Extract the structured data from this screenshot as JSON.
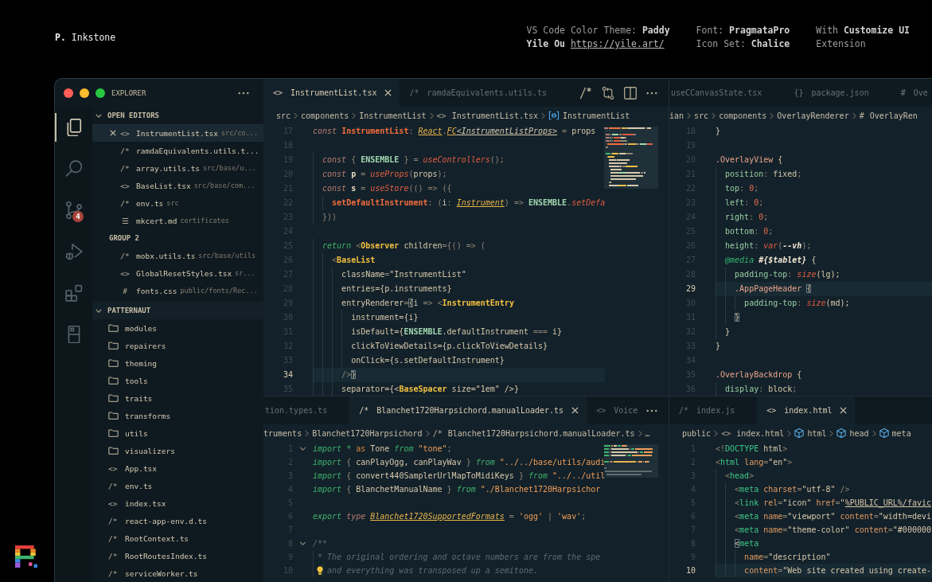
{
  "header": {
    "brand": "**P.** Inkstone",
    "credits": [
      {
        "lines": [
          "VS Code Color Theme: **Paddy**"
        ],
        "author": "Yile Ou",
        "link": "https://yile.art/"
      },
      {
        "lines": [
          "Font: **PragmataPro**",
          "Icon Set: **Chalice**"
        ]
      },
      {
        "lines": [
          "With **Customize UI**",
          "Extension"
        ]
      }
    ]
  },
  "activity_bar": [
    {
      "kind": "explorer",
      "selected": true
    },
    {
      "kind": "search",
      "selected": false
    },
    {
      "kind": "source-control",
      "selected": false,
      "badge": "4"
    },
    {
      "kind": "run-debug",
      "selected": false
    },
    {
      "kind": "extensions",
      "selected": false
    },
    {
      "kind": "device",
      "selected": false
    }
  ],
  "explorer": {
    "title": "EXPLORER",
    "open_editors": {
      "title": "OPEN EDITORS",
      "expanded": true,
      "groups": [
        {
          "items": [
            {
              "icon": "<>",
              "name": "InstrumentList.tsx",
              "path": "src/co...",
              "selected": true
            },
            {
              "icon": "/*",
              "name": "ramdaEquivalents.utils.t...",
              "selected": false
            },
            {
              "icon": "/*",
              "name": "array.utils.ts",
              "path": "src/base/u...",
              "selected": false
            },
            {
              "icon": "<>",
              "name": "BaseList.tsx",
              "path": "src/base/com...",
              "selected": false
            },
            {
              "icon": "/*",
              "name": "env.ts",
              "path": "src",
              "selected": false
            },
            {
              "icon": "☰",
              "name": "mkcert.md",
              "path": "certificates",
              "selected": false
            }
          ]
        },
        {
          "title": "GROUP 2",
          "items": [
            {
              "icon": "/*",
              "name": "mobx.utils.ts",
              "path": "src/base/utils",
              "selected": false
            },
            {
              "icon": "<>",
              "name": "GlobalResetStyles.tsx",
              "path": "sr...",
              "selected": false
            },
            {
              "icon": "#",
              "name": "fonts.css",
              "path": "public/fonts/Rec...",
              "selected": false
            }
          ]
        }
      ]
    },
    "project": {
      "title": "PATTERNAUT",
      "expanded": true,
      "items": [
        {
          "kind": "folder",
          "name": "modules"
        },
        {
          "kind": "folder",
          "name": "repairers"
        },
        {
          "kind": "folder",
          "name": "theming"
        },
        {
          "kind": "folder",
          "name": "tools"
        },
        {
          "kind": "folder",
          "name": "traits"
        },
        {
          "kind": "folder",
          "name": "transforms"
        },
        {
          "kind": "folder",
          "name": "utils"
        },
        {
          "kind": "folder",
          "name": "visualizers"
        },
        {
          "kind": "file",
          "icon": "<>",
          "name": "App.tsx"
        },
        {
          "kind": "file",
          "icon": "/*",
          "name": "env.ts"
        },
        {
          "kind": "file",
          "icon": "<>",
          "name": "index.tsx"
        },
        {
          "kind": "file",
          "icon": "/*",
          "name": "react-app-env.d.ts"
        },
        {
          "kind": "file",
          "icon": "/*",
          "name": "RootContext.ts"
        },
        {
          "kind": "file",
          "icon": "/*",
          "name": "RootRoutesIndex.ts"
        },
        {
          "kind": "file",
          "icon": "/*",
          "name": "serviceWorker.ts"
        }
      ]
    }
  },
  "editors": [
    {
      "tabs": [
        {
          "icon": "<>",
          "label": "InstrumentList.tsx",
          "selected": true
        },
        {
          "icon": "/*",
          "label": "ramdaEquivalents.utils.ts",
          "selected": false
        }
      ],
      "actions": [
        {
          "kind": "toggle-comment"
        },
        {
          "kind": "compare"
        },
        {
          "kind": "split"
        },
        {
          "kind": "more"
        }
      ],
      "breadcrumbs": [
        {
          "kind": "path",
          "text": "src"
        },
        {
          "kind": "path",
          "text": "components"
        },
        {
          "kind": "path",
          "text": "InstrumentList"
        },
        {
          "kind": "file",
          "icon": "<>",
          "text": "InstrumentList.tsx"
        },
        {
          "kind": "variable",
          "text": "InstrumentList"
        }
      ],
      "minimap": true,
      "lines": [
        {
          "number": "17",
          "current": false,
          "tokens": [
            {
              "text": "const ",
              "kind": "keyword"
            },
            {
              "text": "InstrumentList",
              "kind": "decl"
            },
            {
              "text": ": ",
              "kind": "punct"
            },
            {
              "text": "React",
              "kind": "type"
            },
            {
              "text": ".",
              "kind": "punct"
            },
            {
              "text": "FC",
              "kind": "type"
            },
            {
              "text": "<InstrumentListProps>",
              "kind": "typeparam"
            },
            {
              "text": " = ",
              "kind": "punct"
            },
            {
              "text": "props",
              "kind": "plain"
            }
          ]
        },
        {
          "number": "18",
          "current": false
        },
        {
          "number": "19",
          "current": false,
          "tokens": [
            {
              "text": "  const ",
              "kind": "keyword"
            },
            {
              "text": "{ ",
              "kind": "punct"
            },
            {
              "text": "ENSEMBLE",
              "kind": "const"
            },
            {
              "text": " } = ",
              "kind": "punct"
            },
            {
              "text": "useControllers",
              "kind": "func"
            },
            {
              "text": "();",
              "kind": "punct"
            }
          ]
        },
        {
          "number": "20",
          "current": false,
          "tokens": [
            {
              "text": "  const ",
              "kind": "keyword"
            },
            {
              "text": "p",
              "kind": "var"
            },
            {
              "text": " = ",
              "kind": "punct"
            },
            {
              "text": "useProps",
              "kind": "func"
            },
            {
              "text": "(",
              "kind": "punct"
            },
            {
              "text": "props",
              "kind": "plain"
            },
            {
              "text": ");",
              "kind": "punct"
            }
          ]
        },
        {
          "number": "21",
          "current": false,
          "tokens": [
            {
              "text": "  const ",
              "kind": "keyword"
            },
            {
              "text": "s",
              "kind": "var"
            },
            {
              "text": " = ",
              "kind": "punct"
            },
            {
              "text": "useStore",
              "kind": "func"
            },
            {
              "text": "(() => ({",
              "kind": "punct"
            }
          ]
        },
        {
          "number": "22",
          "current": false,
          "tokens": [
            {
              "text": "    setDefaultInstrument",
              "kind": "decl"
            },
            {
              "text": ": (",
              "kind": "punct"
            },
            {
              "text": "i",
              "kind": "plain"
            },
            {
              "text": ": ",
              "kind": "punct"
            },
            {
              "text": "Instrument",
              "kind": "type"
            },
            {
              "text": ") => ",
              "kind": "punct"
            },
            {
              "text": "ENSEMBLE",
              "kind": "const"
            },
            {
              "text": ".",
              "kind": "punct"
            },
            {
              "text": "setDefa",
              "kind": "func"
            }
          ]
        },
        {
          "number": "23",
          "current": false,
          "tokens": [
            {
              "text": "  }))",
              "kind": "punct"
            }
          ]
        },
        {
          "number": "24",
          "current": false
        },
        {
          "number": "25",
          "current": false,
          "tokens": [
            {
              "text": "  return ",
              "kind": "control"
            },
            {
              "text": "<",
              "kind": "punct"
            },
            {
              "text": "Observer",
              "kind": "tag"
            },
            {
              "text": " children",
              "kind": "plain"
            },
            {
              "text": "={() => (",
              "kind": "punct"
            }
          ]
        },
        {
          "number": "26",
          "current": false,
          "tokens": [
            {
              "text": "    <",
              "kind": "punct"
            },
            {
              "text": "BaseList",
              "kind": "tag"
            }
          ]
        },
        {
          "number": "27",
          "current": false,
          "tokens": [
            {
              "text": "      className",
              "kind": "plain"
            },
            {
              "text": "=",
              "kind": "punct"
            },
            {
              "text": "\"InstrumentList\"",
              "kind": "plain"
            }
          ]
        },
        {
          "number": "28",
          "current": false,
          "tokens": [
            {
              "text": "      entries={p.instruments}",
              "kind": "plain"
            }
          ]
        },
        {
          "number": "29",
          "current": false,
          "tokens": [
            {
              "text": "      entryRenderer",
              "kind": "plain"
            },
            {
              "text": "=",
              "kind": "punct"
            },
            {
              "text": "{",
              "kind": "match"
            },
            {
              "text": "i",
              "kind": "plain"
            },
            {
              "text": " => <",
              "kind": "punct"
            },
            {
              "text": "InstrumentEntry",
              "kind": "tag"
            }
          ]
        },
        {
          "number": "30",
          "current": false,
          "tokens": [
            {
              "text": "        instrument={i}",
              "kind": "plain"
            }
          ]
        },
        {
          "number": "31",
          "current": false,
          "tokens": [
            {
              "text": "        isDefault={",
              "kind": "plain"
            },
            {
              "text": "ENSEMBLE",
              "kind": "const"
            },
            {
              "text": ".defaultInstrument ",
              "kind": "plain"
            },
            {
              "text": "===",
              "kind": "punct"
            },
            {
              "text": " i}",
              "kind": "plain"
            }
          ]
        },
        {
          "number": "32",
          "current": false,
          "tokens": [
            {
              "text": "        clickToViewDetails={p.clickToViewDetails}",
              "kind": "plain"
            }
          ]
        },
        {
          "number": "33",
          "current": false,
          "tokens": [
            {
              "text": "        onClick={s.setDefaultInstrument}",
              "kind": "plain"
            }
          ]
        },
        {
          "number": "34",
          "current": true,
          "tokens": [
            {
              "text": "      />",
              "kind": "punct"
            },
            {
              "text": "}",
              "kind": "match"
            }
          ]
        },
        {
          "number": "35",
          "current": false,
          "tokens": [
            {
              "text": "      separator={<",
              "kind": "plain"
            },
            {
              "text": "BaseSpacer",
              "kind": "tag"
            },
            {
              "text": " size=\"1em\" />}",
              "kind": "plain"
            }
          ]
        }
      ]
    },
    {
      "tabs": [
        {
          "label": "useCCanvasState.tsx",
          "selected": false
        },
        {
          "icon": "{}",
          "label": "package.json",
          "selected": false
        },
        {
          "icon": "#",
          "label": "Ove",
          "selected": false
        }
      ],
      "breadcrumbs": [
        {
          "kind": "path",
          "text": "ian"
        },
        {
          "kind": "path",
          "text": "src"
        },
        {
          "kind": "path",
          "text": "components"
        },
        {
          "kind": "path",
          "text": "OverlayRenderer"
        },
        {
          "kind": "file",
          "icon": "#",
          "text": "OverlayRen"
        }
      ],
      "lines": [
        {
          "number": "18",
          "current": false,
          "tokens": [
            {
              "text": "}",
              "kind": "plain"
            }
          ]
        },
        {
          "number": "19",
          "current": false
        },
        {
          "number": "20",
          "current": false,
          "tokens": [
            {
              "text": ".OverlayView",
              "kind": "selector"
            },
            {
              "text": " {",
              "kind": "plain"
            }
          ]
        },
        {
          "number": "21",
          "current": false,
          "tokens": [
            {
              "text": "  position",
              "kind": "property"
            },
            {
              "text": ": ",
              "kind": "punct"
            },
            {
              "text": "fixed",
              "kind": "plain"
            },
            {
              "text": ";",
              "kind": "punct"
            }
          ]
        },
        {
          "number": "22",
          "current": false,
          "tokens": [
            {
              "text": "  top",
              "kind": "property"
            },
            {
              "text": ": ",
              "kind": "punct"
            },
            {
              "text": "0",
              "kind": "number"
            },
            {
              "text": ";",
              "kind": "punct"
            }
          ]
        },
        {
          "number": "23",
          "current": false,
          "tokens": [
            {
              "text": "  left",
              "kind": "property"
            },
            {
              "text": ": ",
              "kind": "punct"
            },
            {
              "text": "0",
              "kind": "number"
            },
            {
              "text": ";",
              "kind": "punct"
            }
          ]
        },
        {
          "number": "24",
          "current": false,
          "tokens": [
            {
              "text": "  right",
              "kind": "property"
            },
            {
              "text": ": ",
              "kind": "punct"
            },
            {
              "text": "0",
              "kind": "number"
            },
            {
              "text": ";",
              "kind": "punct"
            }
          ]
        },
        {
          "number": "25",
          "current": false,
          "tokens": [
            {
              "text": "  bottom",
              "kind": "property"
            },
            {
              "text": ": ",
              "kind": "punct"
            },
            {
              "text": "0",
              "kind": "number"
            },
            {
              "text": ";",
              "kind": "punct"
            }
          ]
        },
        {
          "number": "26",
          "current": false,
          "tokens": [
            {
              "text": "  height",
              "kind": "property"
            },
            {
              "text": ": ",
              "kind": "punct"
            },
            {
              "text": "var",
              "kind": "func"
            },
            {
              "text": "(",
              "kind": "punct"
            },
            {
              "text": "--vh",
              "kind": "interp"
            },
            {
              "text": ");",
              "kind": "punct"
            }
          ]
        },
        {
          "number": "27",
          "current": false,
          "tokens": [
            {
              "text": "  @media ",
              "kind": "atrule"
            },
            {
              "text": "#{$tablet}",
              "kind": "interp"
            },
            {
              "text": " {",
              "kind": "plain"
            }
          ]
        },
        {
          "number": "28",
          "current": false,
          "tokens": [
            {
              "text": "    padding-top",
              "kind": "property"
            },
            {
              "text": ": ",
              "kind": "punct"
            },
            {
              "text": "size",
              "kind": "func"
            },
            {
              "text": "(lg);",
              "kind": "plain"
            }
          ]
        },
        {
          "number": "29",
          "current": true,
          "tokens": [
            {
              "text": "    .AppPageHeader ",
              "kind": "selector"
            },
            {
              "text": "{",
              "kind": "match"
            }
          ]
        },
        {
          "number": "30",
          "current": false,
          "tokens": [
            {
              "text": "      padding-top",
              "kind": "property"
            },
            {
              "text": ": ",
              "kind": "punct"
            },
            {
              "text": "size",
              "kind": "func"
            },
            {
              "text": "(md);",
              "kind": "plain"
            }
          ]
        },
        {
          "number": "31",
          "current": false,
          "tokens": [
            {
              "text": "    }",
              "kind": "match"
            }
          ]
        },
        {
          "number": "32",
          "current": false,
          "tokens": [
            {
              "text": "  }",
              "kind": "plain"
            }
          ]
        },
        {
          "number": "33",
          "current": false,
          "tokens": [
            {
              "text": "}",
              "kind": "plain"
            }
          ]
        },
        {
          "number": "34",
          "current": false
        },
        {
          "number": "35",
          "current": false,
          "tokens": [
            {
              "text": ".OverlayBackdrop",
              "kind": "selector"
            },
            {
              "text": " {",
              "kind": "plain"
            }
          ]
        },
        {
          "number": "36",
          "current": false,
          "tokens": [
            {
              "text": "  display",
              "kind": "property"
            },
            {
              "text": ": ",
              "kind": "punct"
            },
            {
              "text": "block",
              "kind": "plain"
            },
            {
              "text": ";",
              "kind": "punct"
            }
          ]
        }
      ]
    },
    {
      "tabs": [
        {
          "label": "tion.types.ts",
          "selected": false
        },
        {
          "icon": "/*",
          "label": "Blanchet1720Harpsichord.manualLoader.ts",
          "selected": true
        },
        {
          "icon": "<>",
          "label": "Voice",
          "selected": false
        }
      ],
      "actions": [
        {
          "kind": "more"
        }
      ],
      "breadcrumbs": [
        {
          "kind": "path",
          "text": "truments"
        },
        {
          "kind": "path",
          "text": "Blanchet1720Harpsichord"
        },
        {
          "kind": "file",
          "icon": "/*",
          "text": "Blanchet1720Harpsichord.manualLoader.ts"
        },
        {
          "kind": "path",
          "text": "…"
        }
      ],
      "minimap": true,
      "lines": [
        {
          "number": "1",
          "current": false,
          "foldable": true,
          "lightbulb": false,
          "tokens": [
            {
              "text": "import * ",
              "kind": "control"
            },
            {
              "text": "as ",
              "kind": "modifier"
            },
            {
              "text": "Tone ",
              "kind": "plain"
            },
            {
              "text": "from ",
              "kind": "control"
            },
            {
              "text": "\"tone\"",
              "kind": "string"
            },
            {
              "text": ";",
              "kind": "punct"
            }
          ]
        },
        {
          "number": "2",
          "current": false,
          "foldable": false,
          "lightbulb": false,
          "tokens": [
            {
              "text": "import ",
              "kind": "control"
            },
            {
              "text": "{ ",
              "kind": "punct"
            },
            {
              "text": "canPlayOgg, canPlayWav ",
              "kind": "plain"
            },
            {
              "text": "} ",
              "kind": "punct"
            },
            {
              "text": "from ",
              "kind": "control"
            },
            {
              "text": "\"../../base/utils/audi",
              "kind": "string"
            }
          ]
        },
        {
          "number": "3",
          "current": false,
          "foldable": false,
          "lightbulb": false,
          "tokens": [
            {
              "text": "import ",
              "kind": "control"
            },
            {
              "text": "{ ",
              "kind": "punct"
            },
            {
              "text": "convert440SamplerUrlMapToMidiKeys ",
              "kind": "plain"
            },
            {
              "text": "} ",
              "kind": "punct"
            },
            {
              "text": "from ",
              "kind": "control"
            },
            {
              "text": "\"../../util",
              "kind": "string"
            }
          ]
        },
        {
          "number": "4",
          "current": false,
          "foldable": false,
          "lightbulb": false,
          "tokens": [
            {
              "text": "import ",
              "kind": "control"
            },
            {
              "text": "{ ",
              "kind": "punct"
            },
            {
              "text": "BlanchetManualName ",
              "kind": "plain"
            },
            {
              "text": "} ",
              "kind": "punct"
            },
            {
              "text": "from ",
              "kind": "control"
            },
            {
              "text": "\"./Blanchet1720Harpsichor",
              "kind": "string"
            }
          ]
        },
        {
          "number": "5",
          "current": false,
          "foldable": false,
          "lightbulb": false
        },
        {
          "number": "6",
          "current": false,
          "foldable": false,
          "lightbulb": false,
          "tokens": [
            {
              "text": "export ",
              "kind": "control"
            },
            {
              "text": "type ",
              "kind": "keyword"
            },
            {
              "text": "Blanchet1720SupportedFormats",
              "kind": "type"
            },
            {
              "text": " = ",
              "kind": "punct"
            },
            {
              "text": "'ogg'",
              "kind": "string"
            },
            {
              "text": " | ",
              "kind": "punct"
            },
            {
              "text": "'wav'",
              "kind": "string"
            },
            {
              "text": ";",
              "kind": "punct"
            }
          ]
        },
        {
          "number": "7",
          "current": false,
          "foldable": false,
          "lightbulb": false
        },
        {
          "number": "8",
          "current": false,
          "foldable": true,
          "lightbulb": false,
          "tokens": [
            {
              "text": "/**",
              "kind": "comment"
            }
          ]
        },
        {
          "number": "9",
          "current": false,
          "foldable": false,
          "lightbulb": false,
          "tokens": [
            {
              "text": " * The original ordering and octave numbers are from the spe",
              "kind": "comment"
            }
          ]
        },
        {
          "number": "10",
          "current": false,
          "foldable": false,
          "lightbulb": true,
          "tokens": [
            {
              "text": "   and everything was transposed up a semitone.",
              "kind": "comment"
            }
          ]
        }
      ]
    },
    {
      "tabs": [
        {
          "icon": "/*",
          "label": "index.js",
          "selected": false
        },
        {
          "icon": "<>",
          "label": "index.html",
          "selected": true
        }
      ],
      "breadcrumbs": [
        {
          "kind": "path",
          "text": "public"
        },
        {
          "kind": "file",
          "icon": "<>",
          "text": "index.html"
        },
        {
          "kind": "element",
          "text": "html"
        },
        {
          "kind": "element",
          "text": "head"
        },
        {
          "kind": "element",
          "text": "meta"
        }
      ],
      "lines": [
        {
          "number": "1",
          "current": false,
          "tokens": [
            {
              "text": "<!",
              "kind": "punct"
            },
            {
              "text": "DOCTYPE",
              "kind": "htmltag"
            },
            {
              "text": " html",
              "kind": "plain"
            },
            {
              "text": ">",
              "kind": "punct"
            }
          ]
        },
        {
          "number": "2",
          "current": false,
          "tokens": [
            {
              "text": "<",
              "kind": "punct"
            },
            {
              "text": "html",
              "kind": "htmltag"
            },
            {
              "text": " lang",
              "kind": "attr"
            },
            {
              "text": "=",
              "kind": "punct"
            },
            {
              "text": "\"en\"",
              "kind": "plain"
            },
            {
              "text": ">",
              "kind": "punct"
            }
          ]
        },
        {
          "number": "3",
          "current": false,
          "tokens": [
            {
              "text": "  <",
              "kind": "punct"
            },
            {
              "text": "head",
              "kind": "htmltag"
            },
            {
              "text": ">",
              "kind": "punct"
            }
          ]
        },
        {
          "number": "4",
          "current": false,
          "tokens": [
            {
              "text": "    <",
              "kind": "punct"
            },
            {
              "text": "meta",
              "kind": "htmltag"
            },
            {
              "text": " charset",
              "kind": "attr"
            },
            {
              "text": "=",
              "kind": "punct"
            },
            {
              "text": "\"utf-8\"",
              "kind": "plain"
            },
            {
              "text": " />",
              "kind": "punct"
            }
          ]
        },
        {
          "number": "5",
          "current": false,
          "tokens": [
            {
              "text": "    <",
              "kind": "punct"
            },
            {
              "text": "link",
              "kind": "htmltag"
            },
            {
              "text": " rel",
              "kind": "attr"
            },
            {
              "text": "=",
              "kind": "punct"
            },
            {
              "text": "\"icon\"",
              "kind": "plain"
            },
            {
              "text": " href",
              "kind": "attr"
            },
            {
              "text": "=",
              "kind": "punct"
            },
            {
              "text": "\"",
              "kind": "plain"
            },
            {
              "text": "%PUBLIC_URL%/favic",
              "kind": "url"
            }
          ]
        },
        {
          "number": "6",
          "current": false,
          "tokens": [
            {
              "text": "    <",
              "kind": "punct"
            },
            {
              "text": "meta",
              "kind": "htmltag"
            },
            {
              "text": " name",
              "kind": "attr"
            },
            {
              "text": "=",
              "kind": "punct"
            },
            {
              "text": "\"viewport\"",
              "kind": "plain"
            },
            {
              "text": " content",
              "kind": "attr"
            },
            {
              "text": "=",
              "kind": "punct"
            },
            {
              "text": "\"width=devi",
              "kind": "plain"
            }
          ]
        },
        {
          "number": "7",
          "current": false,
          "tokens": [
            {
              "text": "    <",
              "kind": "punct"
            },
            {
              "text": "meta",
              "kind": "htmltag"
            },
            {
              "text": " name",
              "kind": "attr"
            },
            {
              "text": "=",
              "kind": "punct"
            },
            {
              "text": "\"theme-color\"",
              "kind": "plain"
            },
            {
              "text": " content",
              "kind": "attr"
            },
            {
              "text": "=",
              "kind": "punct"
            },
            {
              "text": "\"#000000",
              "kind": "plain"
            }
          ]
        },
        {
          "number": "8",
          "current": false,
          "tokens": [
            {
              "text": "    <",
              "kind": "match"
            },
            {
              "text": "meta",
              "kind": "htmltag"
            }
          ]
        },
        {
          "number": "9",
          "current": false,
          "tokens": [
            {
              "text": "      name",
              "kind": "attr"
            },
            {
              "text": "=",
              "kind": "punct"
            },
            {
              "text": "\"description\"",
              "kind": "plain"
            }
          ]
        },
        {
          "number": "10",
          "current": true,
          "tokens": [
            {
              "text": "      content",
              "kind": "attr"
            },
            {
              "text": "=",
              "kind": "punct"
            },
            {
              "text": "\"Web site created using create-",
              "kind": "plain"
            }
          ]
        }
      ]
    }
  ]
}
